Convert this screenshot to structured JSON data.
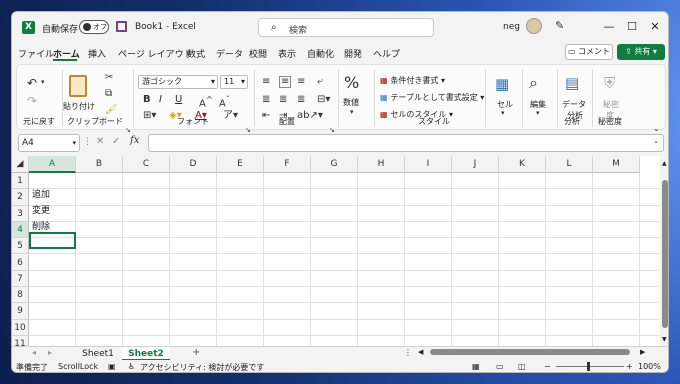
{
  "app": {
    "autosave_label": "自動保存",
    "autosave_state": "オフ",
    "doc_title": "Book1  -  Excel",
    "search_placeholder": "検索",
    "user_name": "neg",
    "window_controls": {
      "minimize": "—",
      "maximize": "☐",
      "close": "✕"
    }
  },
  "menu": {
    "tabs": [
      "ファイル",
      "ホーム",
      "挿入",
      "ページ レイアウト",
      "数式",
      "データ",
      "校閲",
      "表示",
      "自動化",
      "開発",
      "ヘルプ"
    ],
    "active_tab": "ホーム",
    "comment_label": "コメント",
    "share_label": "共有"
  },
  "ribbon": {
    "undo_group": "元に戻す",
    "clipboard": {
      "paste_label": "貼り付け",
      "group_label": "クリップボード"
    },
    "font": {
      "name": "游ゴシック",
      "size": "11",
      "group_label": "フォント",
      "bold": "B",
      "italic": "I",
      "underline": "U"
    },
    "alignment": {
      "group_label": "配置"
    },
    "number": {
      "label": "数値"
    },
    "styles": {
      "conditional": "条件付き書式",
      "table": "テーブルとして書式設定",
      "cell_style": "セルのスタイル",
      "group_label": "スタイル"
    },
    "cells": {
      "label": "セル"
    },
    "editing": {
      "label": "編集"
    },
    "analysis": {
      "data_analysis_line1": "データ",
      "data_analysis_line2": "分析",
      "group_label": "分析"
    },
    "sensitivity": {
      "label_line1": "秘密",
      "label_line2": "度",
      "group_label": "秘密度"
    }
  },
  "formula_bar": {
    "name_box": "A4",
    "fx": "fx",
    "value": ""
  },
  "grid": {
    "columns": [
      "A",
      "B",
      "C",
      "D",
      "E",
      "F",
      "G",
      "H",
      "I",
      "J",
      "K",
      "L",
      "M"
    ],
    "rows": [
      "1",
      "2",
      "3",
      "4",
      "5",
      "6",
      "7",
      "8",
      "9",
      "10",
      "11"
    ],
    "cells": {
      "A1": "追加",
      "A2": "変更",
      "A3": "削除"
    },
    "selected_cell": "A4"
  },
  "sheets": {
    "tabs": [
      "Sheet1",
      "Sheet2"
    ],
    "active": "Sheet2",
    "add_label": "+"
  },
  "status_bar": {
    "ready": "準備完了",
    "scroll_lock": "ScrollLock",
    "accessibility": "アクセシビリティ: 検討が必要です",
    "zoom": "100%",
    "zoom_minus": "−",
    "zoom_plus": "+"
  }
}
